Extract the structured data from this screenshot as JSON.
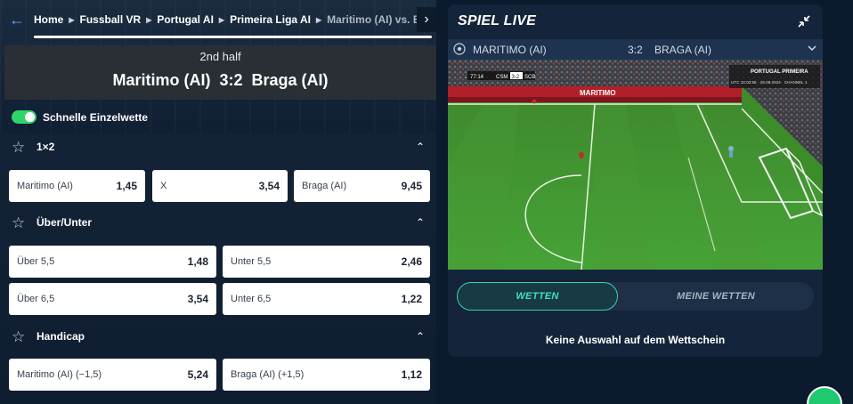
{
  "breadcrumb": {
    "items": [
      "Home",
      "Fussball VR",
      "Portugal AI",
      "Primeira Liga AI",
      "Maritimo (AI) vs. Br"
    ]
  },
  "match": {
    "phase": "2nd half",
    "score_line": "Maritimo (AI)  3:2  Braga (AI)"
  },
  "quick_bet": {
    "label": "Schnelle Einzelwette",
    "enabled": true
  },
  "markets": {
    "m1x2": {
      "title": "1×2",
      "odds": [
        {
          "label": "Maritimo (AI)",
          "value": "1,45"
        },
        {
          "label": "X",
          "value": "3,54"
        },
        {
          "label": "Braga (AI)",
          "value": "9,45"
        }
      ]
    },
    "overunder": {
      "title": "Über/Unter",
      "odds": [
        {
          "label": "Über 5,5",
          "value": "1,48"
        },
        {
          "label": "Unter 5,5",
          "value": "2,46"
        },
        {
          "label": "Über 6,5",
          "value": "3,54"
        },
        {
          "label": "Unter 6,5",
          "value": "1,22"
        }
      ]
    },
    "handicap": {
      "title": "Handicap",
      "odds": [
        {
          "label": "Maritimo (AI) (−1,5)",
          "value": "5,24"
        },
        {
          "label": "Braga (AI) (+1,5)",
          "value": "1,12"
        }
      ]
    }
  },
  "live": {
    "title": "SPIEL LIVE",
    "home": "MARITIMO (AI)",
    "score": "3:2",
    "away": "BRAGA (AI)",
    "video": {
      "time": "77:14",
      "home_abbr": "CSM",
      "score": "3-2",
      "away_abbr": "SCB",
      "league": "PORTUGAL PRIMEIRA",
      "info_line": "UTC 10:03:56 · 28.08.2024 · CHANNEL 1",
      "banner": "MARITIMO"
    }
  },
  "betslip": {
    "tab_active": "WETTEN",
    "tab_inactive": "MEINE WETTEN",
    "empty_text": "Keine Auswahl auf dem Wettschein"
  },
  "colors": {
    "accent_green": "#2fd46b",
    "tab_accent": "#3ee0c5",
    "link_blue": "#5aa9ff"
  }
}
